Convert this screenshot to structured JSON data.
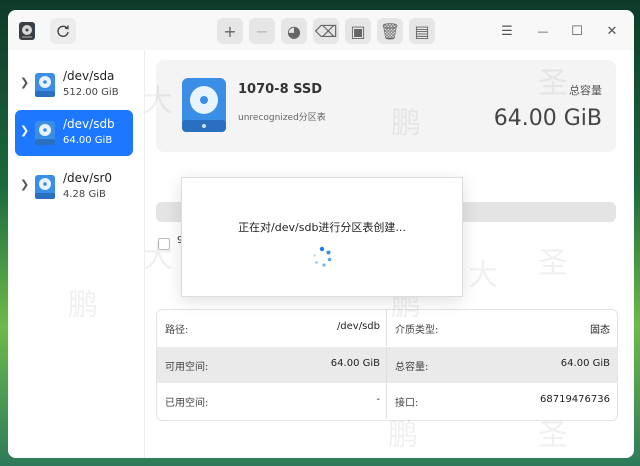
{
  "toolbar": {
    "buttons": [
      {
        "icon": "plus-icon",
        "glyph": "+",
        "enabled": true
      },
      {
        "icon": "minus-icon",
        "glyph": "−",
        "enabled": false
      },
      {
        "icon": "pie-icon",
        "glyph": "◕",
        "enabled": true
      },
      {
        "icon": "eraser-icon",
        "glyph": "⌫",
        "enabled": true
      },
      {
        "icon": "mount-icon",
        "glyph": "▣",
        "enabled": true
      },
      {
        "icon": "trash-icon",
        "glyph": "🗑",
        "enabled": true
      },
      {
        "icon": "book-icon",
        "glyph": "▤",
        "enabled": true
      }
    ]
  },
  "window_controls": {
    "menu": "☰",
    "minimize": "—",
    "maximize": "☐",
    "close": "✕"
  },
  "sidebar": {
    "disks": [
      {
        "name": "/dev/sda",
        "size": "512.00 GiB",
        "selected": false
      },
      {
        "name": "/dev/sdb",
        "size": "64.00 GiB",
        "selected": true
      },
      {
        "name": "/dev/sr0",
        "size": "4.28 GiB",
        "selected": false
      }
    ]
  },
  "info": {
    "model": "1070-8 SSD",
    "partition_table": "unrecognized分区表",
    "capacity_label": "总容量",
    "capacity_value": "64.00 GiB"
  },
  "legend_text": "9",
  "properties": [
    {
      "left_label": "路径:",
      "left_value": "/dev/sdb",
      "right_label": "介质类型:",
      "right_value": "固态"
    },
    {
      "left_label": "可用空间:",
      "left_value": "64.00 GiB",
      "right_label": "总容量:",
      "right_value": "64.00 GiB"
    },
    {
      "left_label": "已用空间:",
      "left_value": "-",
      "right_label": "接口:",
      "right_value": "68719476736"
    }
  ],
  "overlay": {
    "message": "正在对/dev/sdb进行分区表创建..."
  },
  "watermark": {
    "chars": [
      "大",
      "圣",
      "鹏"
    ]
  },
  "colors": {
    "accent": "#1e78ff",
    "disk_icon": "#3a8ee6"
  }
}
